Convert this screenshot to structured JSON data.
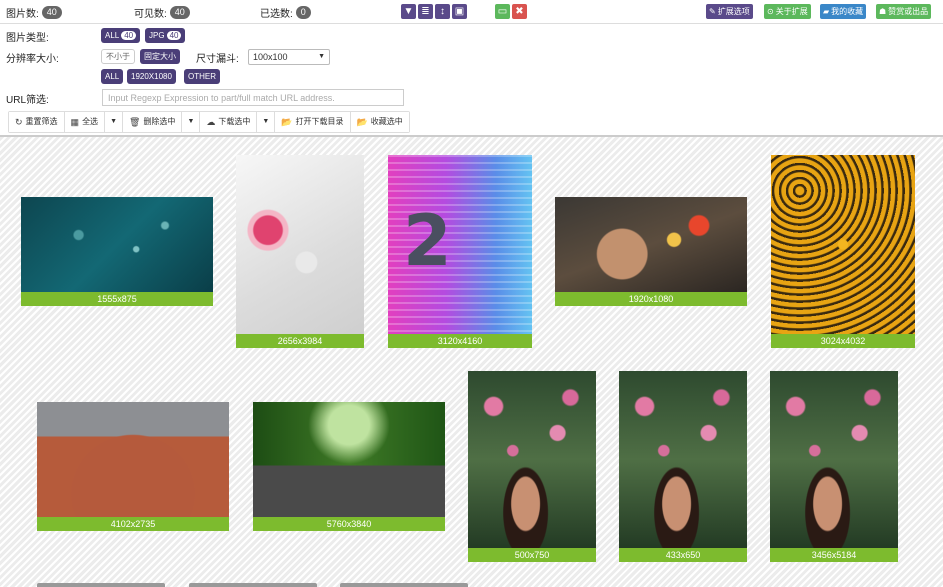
{
  "topbar": {
    "stats": [
      {
        "label": "图片数:",
        "count": "40"
      },
      {
        "label": "可见数:",
        "count": "40"
      },
      {
        "label": "已选数:",
        "count": "0"
      }
    ],
    "tools": [
      {
        "icon": "filter-icon",
        "glyph": "▼"
      },
      {
        "icon": "list-icon",
        "glyph": "≣"
      },
      {
        "icon": "sort-icon",
        "glyph": "↕"
      },
      {
        "icon": "image-icon",
        "glyph": "▣"
      },
      {
        "icon": "select-all-icon",
        "glyph": "▭"
      },
      {
        "icon": "close-icon",
        "glyph": "✖"
      }
    ],
    "links": [
      {
        "label": "扩展选项",
        "icon_glyph": "✎"
      },
      {
        "label": "关于扩展",
        "icon_glyph": "⊙"
      },
      {
        "label": "我的收藏",
        "icon_glyph": "▰"
      },
      {
        "label": "赞赏或出品",
        "icon_glyph": "☗"
      }
    ]
  },
  "filters": {
    "type_label": "图片类型:",
    "type_options": [
      {
        "label": "ALL",
        "count": "40"
      },
      {
        "label": "JPG",
        "count": "40"
      }
    ],
    "resolution_label": "分辨率大小:",
    "size_modes": [
      "不小于",
      "固定大小"
    ],
    "size_step_label": "尺寸漏斗:",
    "size_step_value": "100x100",
    "resolution_options": [
      "ALL",
      "1920X1080",
      "OTHER"
    ],
    "url_label": "URL筛选:",
    "url_placeholder": "Input Regexp Expression to part/full match URL address."
  },
  "actions": [
    {
      "label": "重置筛选",
      "glyph": "↻"
    },
    {
      "label": "全选",
      "glyph": "▦"
    },
    {
      "label": "",
      "glyph": "▼"
    },
    {
      "label": "删除选中",
      "glyph": "🗑"
    },
    {
      "label": "",
      "glyph": "▼"
    },
    {
      "label": "下载选中",
      "glyph": "☁"
    },
    {
      "label": "",
      "glyph": "▼"
    },
    {
      "label": "打开下载目录",
      "glyph": "📂"
    },
    {
      "label": "收藏选中",
      "glyph": "📂"
    }
  ],
  "images": [
    {
      "caption": "1555x875",
      "art": "aerial-water"
    },
    {
      "caption": "2656x3984",
      "art": "pink-tea"
    },
    {
      "caption": "3120x4160",
      "art": "neon-two"
    },
    {
      "caption": "1920x1080",
      "art": "food"
    },
    {
      "caption": "3024x4032",
      "art": "flowers"
    },
    {
      "caption": "4102x2735",
      "art": "skater"
    },
    {
      "caption": "5760x3840",
      "art": "forest-road"
    },
    {
      "caption": "500x750",
      "art": "girl-flowers"
    },
    {
      "caption": "433x650",
      "art": "girl-flowers"
    },
    {
      "caption": "3456x5184",
      "art": "girl-flowers"
    }
  ]
}
